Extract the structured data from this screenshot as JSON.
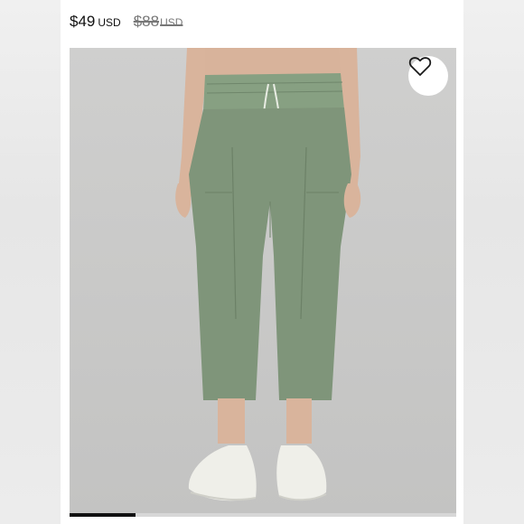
{
  "listing": {
    "price_current": "$49",
    "price_current_currency": "USD",
    "price_original": "$88",
    "price_original_currency": "USD"
  },
  "image": {
    "favorite_icon": "heart-outline-icon",
    "gallery_progress": 0.17
  },
  "colors": {
    "photo_bg": "#c9c9c8",
    "pants": "#7f957a",
    "shoes": "#efefe9",
    "progress": "#111111"
  }
}
